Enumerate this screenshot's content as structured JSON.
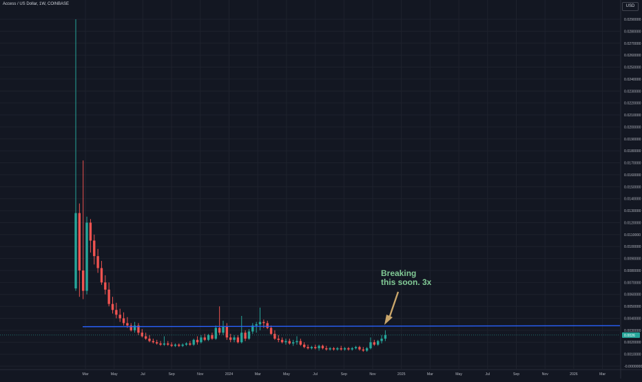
{
  "header": {
    "title": "Access / US Dollar, 1W, COINBASE",
    "currency_badge": "USD"
  },
  "annotation": {
    "text": "Breaking\nthis soon. 3x"
  },
  "colors": {
    "background": "#131722",
    "grid": "#1e222d",
    "up": "#26a69a",
    "down": "#ef5350",
    "resistance_line": "#2962ff",
    "annotation_text": "#81c995",
    "arrow": "#c9a66b",
    "price_label_bg": "#26a69a"
  },
  "chart_data": {
    "type": "candlestick",
    "timeframe": "1W",
    "x_tick_labels": [
      "Mar",
      "May",
      "Jul",
      "Sep",
      "Nov",
      "2024",
      "Mar",
      "May",
      "Jul",
      "Sep",
      "Nov",
      "2025",
      "Mar",
      "May",
      "Jul",
      "Sep",
      "Nov",
      "2026",
      "Mar"
    ],
    "y_tick_labels": [
      "0.0290000",
      "0.0280000",
      "0.0270000",
      "0.0260000",
      "0.0250000",
      "0.0240000",
      "0.0230000",
      "0.0220000",
      "0.0210000",
      "0.0200000",
      "0.0190000",
      "0.0180000",
      "0.0170000",
      "0.0160000",
      "0.0150000",
      "0.0140000",
      "0.0130000",
      "0.0120000",
      "0.0110000",
      "0.0100000",
      "0.0090000",
      "0.0080000",
      "0.0070000",
      "0.0060000",
      "0.0050000",
      "0.0040000",
      "0.0030000",
      "0.0020000",
      "0.0010000",
      "-0.0000000"
    ],
    "ylim": [
      0,
      0.0295
    ],
    "resistance_level": 0.0033,
    "last_price_label": "0.0026",
    "candles": [
      {
        "o": 0.0065,
        "h": 0.029,
        "l": 0.0063,
        "c": 0.0128
      },
      {
        "o": 0.0128,
        "h": 0.0136,
        "l": 0.0058,
        "c": 0.008
      },
      {
        "o": 0.008,
        "h": 0.0172,
        "l": 0.0056,
        "c": 0.0063
      },
      {
        "o": 0.0063,
        "h": 0.0125,
        "l": 0.006,
        "c": 0.012
      },
      {
        "o": 0.012,
        "h": 0.0123,
        "l": 0.0095,
        "c": 0.0105
      },
      {
        "o": 0.0105,
        "h": 0.011,
        "l": 0.0085,
        "c": 0.0092
      },
      {
        "o": 0.0092,
        "h": 0.0098,
        "l": 0.0078,
        "c": 0.0082
      },
      {
        "o": 0.0082,
        "h": 0.0088,
        "l": 0.0068,
        "c": 0.007
      },
      {
        "o": 0.007,
        "h": 0.0076,
        "l": 0.006,
        "c": 0.0064
      },
      {
        "o": 0.0064,
        "h": 0.007,
        "l": 0.005,
        "c": 0.0052
      },
      {
        "o": 0.0052,
        "h": 0.0058,
        "l": 0.0044,
        "c": 0.0047
      },
      {
        "o": 0.0047,
        "h": 0.0053,
        "l": 0.004,
        "c": 0.0043
      },
      {
        "o": 0.0043,
        "h": 0.0048,
        "l": 0.0037,
        "c": 0.004
      },
      {
        "o": 0.004,
        "h": 0.0045,
        "l": 0.0034,
        "c": 0.0036
      },
      {
        "o": 0.0036,
        "h": 0.0041,
        "l": 0.0032,
        "c": 0.0034
      },
      {
        "o": 0.0034,
        "h": 0.0036,
        "l": 0.0029,
        "c": 0.003
      },
      {
        "o": 0.003,
        "h": 0.0037,
        "l": 0.0028,
        "c": 0.0034
      },
      {
        "o": 0.0034,
        "h": 0.0036,
        "l": 0.0026,
        "c": 0.0028
      },
      {
        "o": 0.0028,
        "h": 0.0031,
        "l": 0.0024,
        "c": 0.0025
      },
      {
        "o": 0.0025,
        "h": 0.0028,
        "l": 0.0022,
        "c": 0.0023
      },
      {
        "o": 0.0023,
        "h": 0.0026,
        "l": 0.002,
        "c": 0.0021
      },
      {
        "o": 0.0021,
        "h": 0.0023,
        "l": 0.0019,
        "c": 0.002
      },
      {
        "o": 0.002,
        "h": 0.0022,
        "l": 0.0018,
        "c": 0.0019
      },
      {
        "o": 0.0019,
        "h": 0.0021,
        "l": 0.0017,
        "c": 0.0018
      },
      {
        "o": 0.0018,
        "h": 0.0025,
        "l": 0.0017,
        "c": 0.0019
      },
      {
        "o": 0.0019,
        "h": 0.0021,
        "l": 0.0017,
        "c": 0.0018
      },
      {
        "o": 0.0018,
        "h": 0.002,
        "l": 0.0016,
        "c": 0.0017
      },
      {
        "o": 0.0017,
        "h": 0.0019,
        "l": 0.0016,
        "c": 0.0018
      },
      {
        "o": 0.0018,
        "h": 0.0019,
        "l": 0.0016,
        "c": 0.0017
      },
      {
        "o": 0.0017,
        "h": 0.0019,
        "l": 0.0016,
        "c": 0.0018
      },
      {
        "o": 0.0018,
        "h": 0.002,
        "l": 0.0017,
        "c": 0.0019
      },
      {
        "o": 0.0019,
        "h": 0.0021,
        "l": 0.0017,
        "c": 0.0018
      },
      {
        "o": 0.0018,
        "h": 0.0023,
        "l": 0.0017,
        "c": 0.0022
      },
      {
        "o": 0.0022,
        "h": 0.0025,
        "l": 0.0018,
        "c": 0.002
      },
      {
        "o": 0.002,
        "h": 0.0026,
        "l": 0.0019,
        "c": 0.0024
      },
      {
        "o": 0.0024,
        "h": 0.0027,
        "l": 0.0021,
        "c": 0.0022
      },
      {
        "o": 0.0022,
        "h": 0.0027,
        "l": 0.0021,
        "c": 0.0026
      },
      {
        "o": 0.0026,
        "h": 0.0028,
        "l": 0.0022,
        "c": 0.0023
      },
      {
        "o": 0.0023,
        "h": 0.0034,
        "l": 0.0022,
        "c": 0.0032
      },
      {
        "o": 0.0032,
        "h": 0.005,
        "l": 0.0026,
        "c": 0.0028
      },
      {
        "o": 0.0028,
        "h": 0.0038,
        "l": 0.0026,
        "c": 0.0033
      },
      {
        "o": 0.0033,
        "h": 0.0036,
        "l": 0.0022,
        "c": 0.0024
      },
      {
        "o": 0.0024,
        "h": 0.0027,
        "l": 0.002,
        "c": 0.0022
      },
      {
        "o": 0.0022,
        "h": 0.0026,
        "l": 0.002,
        "c": 0.0024
      },
      {
        "o": 0.0024,
        "h": 0.0026,
        "l": 0.0019,
        "c": 0.002
      },
      {
        "o": 0.002,
        "h": 0.0042,
        "l": 0.0019,
        "c": 0.0028
      },
      {
        "o": 0.0028,
        "h": 0.003,
        "l": 0.0021,
        "c": 0.0023
      },
      {
        "o": 0.0023,
        "h": 0.0031,
        "l": 0.0022,
        "c": 0.0029
      },
      {
        "o": 0.0029,
        "h": 0.0036,
        "l": 0.0027,
        "c": 0.0034
      },
      {
        "o": 0.0034,
        "h": 0.0037,
        "l": 0.0028,
        "c": 0.0035
      },
      {
        "o": 0.0035,
        "h": 0.0049,
        "l": 0.003,
        "c": 0.0037
      },
      {
        "o": 0.0037,
        "h": 0.0039,
        "l": 0.0032,
        "c": 0.0036
      },
      {
        "o": 0.0036,
        "h": 0.0038,
        "l": 0.0031,
        "c": 0.0032
      },
      {
        "o": 0.0032,
        "h": 0.0034,
        "l": 0.0026,
        "c": 0.0027
      },
      {
        "o": 0.0027,
        "h": 0.003,
        "l": 0.0022,
        "c": 0.0023
      },
      {
        "o": 0.0023,
        "h": 0.0026,
        "l": 0.002,
        "c": 0.0022
      },
      {
        "o": 0.0022,
        "h": 0.0024,
        "l": 0.0019,
        "c": 0.002
      },
      {
        "o": 0.002,
        "h": 0.0023,
        "l": 0.0018,
        "c": 0.0021
      },
      {
        "o": 0.0021,
        "h": 0.0023,
        "l": 0.0018,
        "c": 0.0019
      },
      {
        "o": 0.0019,
        "h": 0.0022,
        "l": 0.0017,
        "c": 0.002
      },
      {
        "o": 0.002,
        "h": 0.0025,
        "l": 0.0018,
        "c": 0.0021
      },
      {
        "o": 0.0021,
        "h": 0.0023,
        "l": 0.0017,
        "c": 0.0018
      },
      {
        "o": 0.0018,
        "h": 0.002,
        "l": 0.0015,
        "c": 0.0016
      },
      {
        "o": 0.0016,
        "h": 0.0018,
        "l": 0.0014,
        "c": 0.0015
      },
      {
        "o": 0.0015,
        "h": 0.0017,
        "l": 0.0014,
        "c": 0.0016
      },
      {
        "o": 0.0016,
        "h": 0.0018,
        "l": 0.0014,
        "c": 0.0015
      },
      {
        "o": 0.0015,
        "h": 0.0018,
        "l": 0.0013,
        "c": 0.0017
      },
      {
        "o": 0.0017,
        "h": 0.0018,
        "l": 0.0014,
        "c": 0.0015
      },
      {
        "o": 0.0015,
        "h": 0.0017,
        "l": 0.0013,
        "c": 0.0014
      },
      {
        "o": 0.0014,
        "h": 0.0016,
        "l": 0.0013,
        "c": 0.0015
      },
      {
        "o": 0.0015,
        "h": 0.0016,
        "l": 0.0013,
        "c": 0.0014
      },
      {
        "o": 0.0014,
        "h": 0.0016,
        "l": 0.0013,
        "c": 0.0015
      },
      {
        "o": 0.0015,
        "h": 0.0017,
        "l": 0.0013,
        "c": 0.0014
      },
      {
        "o": 0.0014,
        "h": 0.0016,
        "l": 0.0013,
        "c": 0.0015
      },
      {
        "o": 0.0015,
        "h": 0.0016,
        "l": 0.0013,
        "c": 0.0014
      },
      {
        "o": 0.0014,
        "h": 0.0016,
        "l": 0.0013,
        "c": 0.0015
      },
      {
        "o": 0.0015,
        "h": 0.0017,
        "l": 0.0014,
        "c": 0.0016
      },
      {
        "o": 0.0016,
        "h": 0.0017,
        "l": 0.0013,
        "c": 0.0014
      },
      {
        "o": 0.0014,
        "h": 0.0016,
        "l": 0.0012,
        "c": 0.0013
      },
      {
        "o": 0.0013,
        "h": 0.0016,
        "l": 0.0012,
        "c": 0.0015
      },
      {
        "o": 0.0015,
        "h": 0.0024,
        "l": 0.0014,
        "c": 0.002
      },
      {
        "o": 0.002,
        "h": 0.0022,
        "l": 0.0017,
        "c": 0.0018
      },
      {
        "o": 0.0018,
        "h": 0.0022,
        "l": 0.0017,
        "c": 0.0021
      },
      {
        "o": 0.0021,
        "h": 0.0026,
        "l": 0.0019,
        "c": 0.0023
      },
      {
        "o": 0.0023,
        "h": 0.003,
        "l": 0.0021,
        "c": 0.0026
      }
    ]
  }
}
